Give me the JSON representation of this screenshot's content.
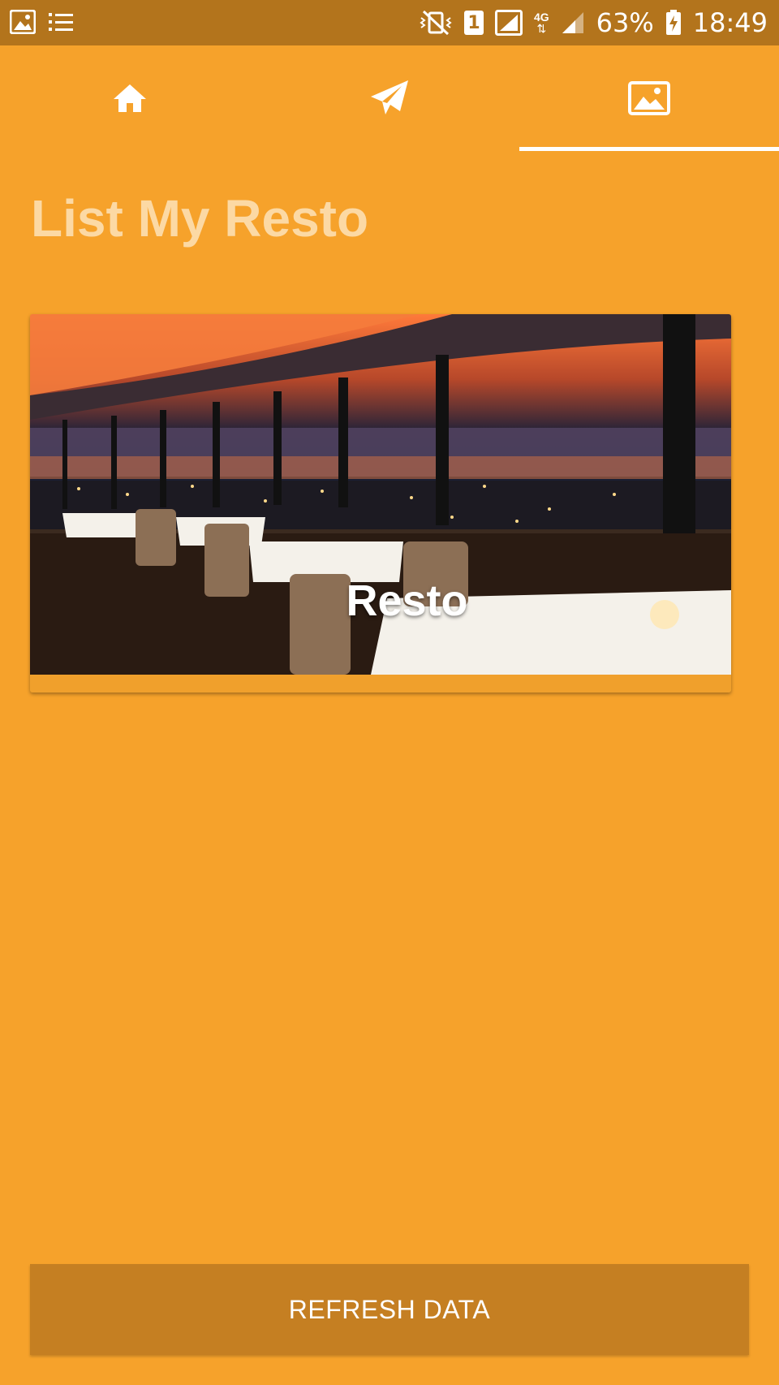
{
  "status_bar": {
    "sim_number": "1",
    "network_type": "4G",
    "battery": "63%",
    "time": "18:49"
  },
  "tabs": [
    {
      "icon": "home-icon",
      "selected": false
    },
    {
      "icon": "paper-plane-icon",
      "selected": false
    },
    {
      "icon": "image-icon",
      "selected": true
    }
  ],
  "page": {
    "title": "List My Resto"
  },
  "restaurants": [
    {
      "name": "Resto",
      "image": "restaurant-interior-photo"
    }
  ],
  "actions": {
    "refresh_label": "REFRESH DATA"
  },
  "colors": {
    "background": "#f6a22b",
    "status_bar": "#b3741c",
    "title_text": "#fcd9a4",
    "button": "#c57f22"
  }
}
